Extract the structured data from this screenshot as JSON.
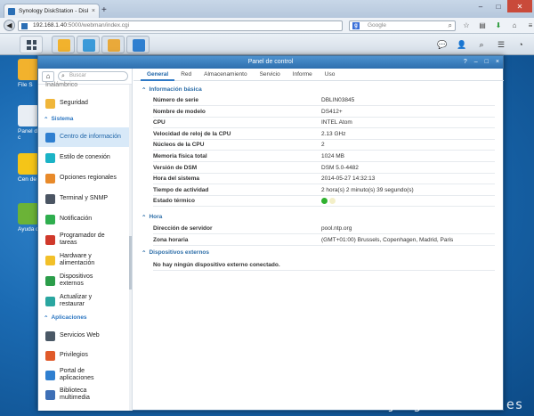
{
  "browser": {
    "tab_title": "Synology DiskStation - DiskSt...",
    "url_host": "192.168.1.40",
    "url_rest": ":5000/webman/index.cgi",
    "search_placeholder": "Google"
  },
  "desktop_icons": [
    {
      "label": "File S",
      "color": "#f2b22d"
    },
    {
      "label": "Panel de c",
      "color": "#e9eef4"
    },
    {
      "label": "Cen de p",
      "color": "#f5c518"
    },
    {
      "label": "Ayuda d",
      "color": "#6bb337"
    }
  ],
  "window": {
    "title": "Panel de control",
    "controls": [
      "?",
      "–",
      "□",
      "×"
    ]
  },
  "sidebar": {
    "search_placeholder": "Buscar",
    "cut_item": "Inalámbrico",
    "items_top": [
      {
        "label": "Seguridad",
        "icon": "shield-icon",
        "color": "#f0b63a"
      }
    ],
    "section_system": "Sistema",
    "items_system": [
      {
        "label": "Centro de información",
        "icon": "info-icon",
        "color": "#2f7fd0",
        "active": true
      },
      {
        "label": "Estilo de conexión",
        "icon": "palette-icon",
        "color": "#1bb3c6"
      },
      {
        "label": "Opciones regionales",
        "icon": "clock-icon",
        "color": "#e88a2a"
      },
      {
        "label": "Terminal y SNMP",
        "icon": "terminal-icon",
        "color": "#4b5563"
      },
      {
        "label": "Notificación",
        "icon": "chat-icon",
        "color": "#2fae4e"
      },
      {
        "label": "Programador de tareas",
        "icon": "calendar-icon",
        "color": "#d0392b"
      },
      {
        "label": "Hardware y alimentación",
        "icon": "bulb-icon",
        "color": "#f2c029"
      },
      {
        "label": "Dispositivos externos",
        "icon": "usb-icon",
        "color": "#2b9d4a"
      },
      {
        "label": "Actualizar y restaurar",
        "icon": "refresh-icon",
        "color": "#2aa6a0"
      }
    ],
    "section_apps": "Aplicaciones",
    "items_apps": [
      {
        "label": "Servicios Web",
        "icon": "web-icon",
        "color": "#4a5866"
      },
      {
        "label": "Privilegios",
        "icon": "privileges-icon",
        "color": "#e05a2a"
      },
      {
        "label": "Portal de aplicaciones",
        "icon": "portal-icon",
        "color": "#2f7fd0"
      },
      {
        "label": "Biblioteca multimedia",
        "icon": "media-icon",
        "color": "#3d6fb6"
      }
    ]
  },
  "tabs": [
    "General",
    "Red",
    "Almacenamiento",
    "Servicio",
    "Informe",
    "Uso"
  ],
  "sections": {
    "basic": "Información básica",
    "time": "Hora",
    "external": "Dispositivos externos"
  },
  "basic_info": [
    {
      "k": "Número de serie",
      "v": "DBLIN03845"
    },
    {
      "k": "Nombre de modelo",
      "v": "DS412+"
    },
    {
      "k": "CPU",
      "v": "INTEL Atom"
    },
    {
      "k": "Velocidad de reloj de la CPU",
      "v": "2.13 GHz"
    },
    {
      "k": "Núcleos de la CPU",
      "v": "2"
    },
    {
      "k": "Memoria física total",
      "v": "1024 MB"
    },
    {
      "k": "Versión de DSM",
      "v": "DSM 5.0-4482"
    },
    {
      "k": "Hora del sistema",
      "v": "2014-05-27 14:32:13"
    },
    {
      "k": "Tiempo de actividad",
      "v": "2 hora(s) 2 minuto(s) 39 segundo(s)"
    },
    {
      "k": "Estado térmico",
      "v": ""
    }
  ],
  "time_info": [
    {
      "k": "Dirección de servidor",
      "v": "pool.ntp.org"
    },
    {
      "k": "Zona horaria",
      "v": "(GMT+01:00) Brussels, Copenhagen, Madrid, Paris"
    }
  ],
  "external_msg": "No hay ningún dispositivo externo conectado.",
  "thermal_colors": [
    "#2fb12f",
    "#f3efc8"
  ],
  "watermark": "jorgedelacruz.es"
}
